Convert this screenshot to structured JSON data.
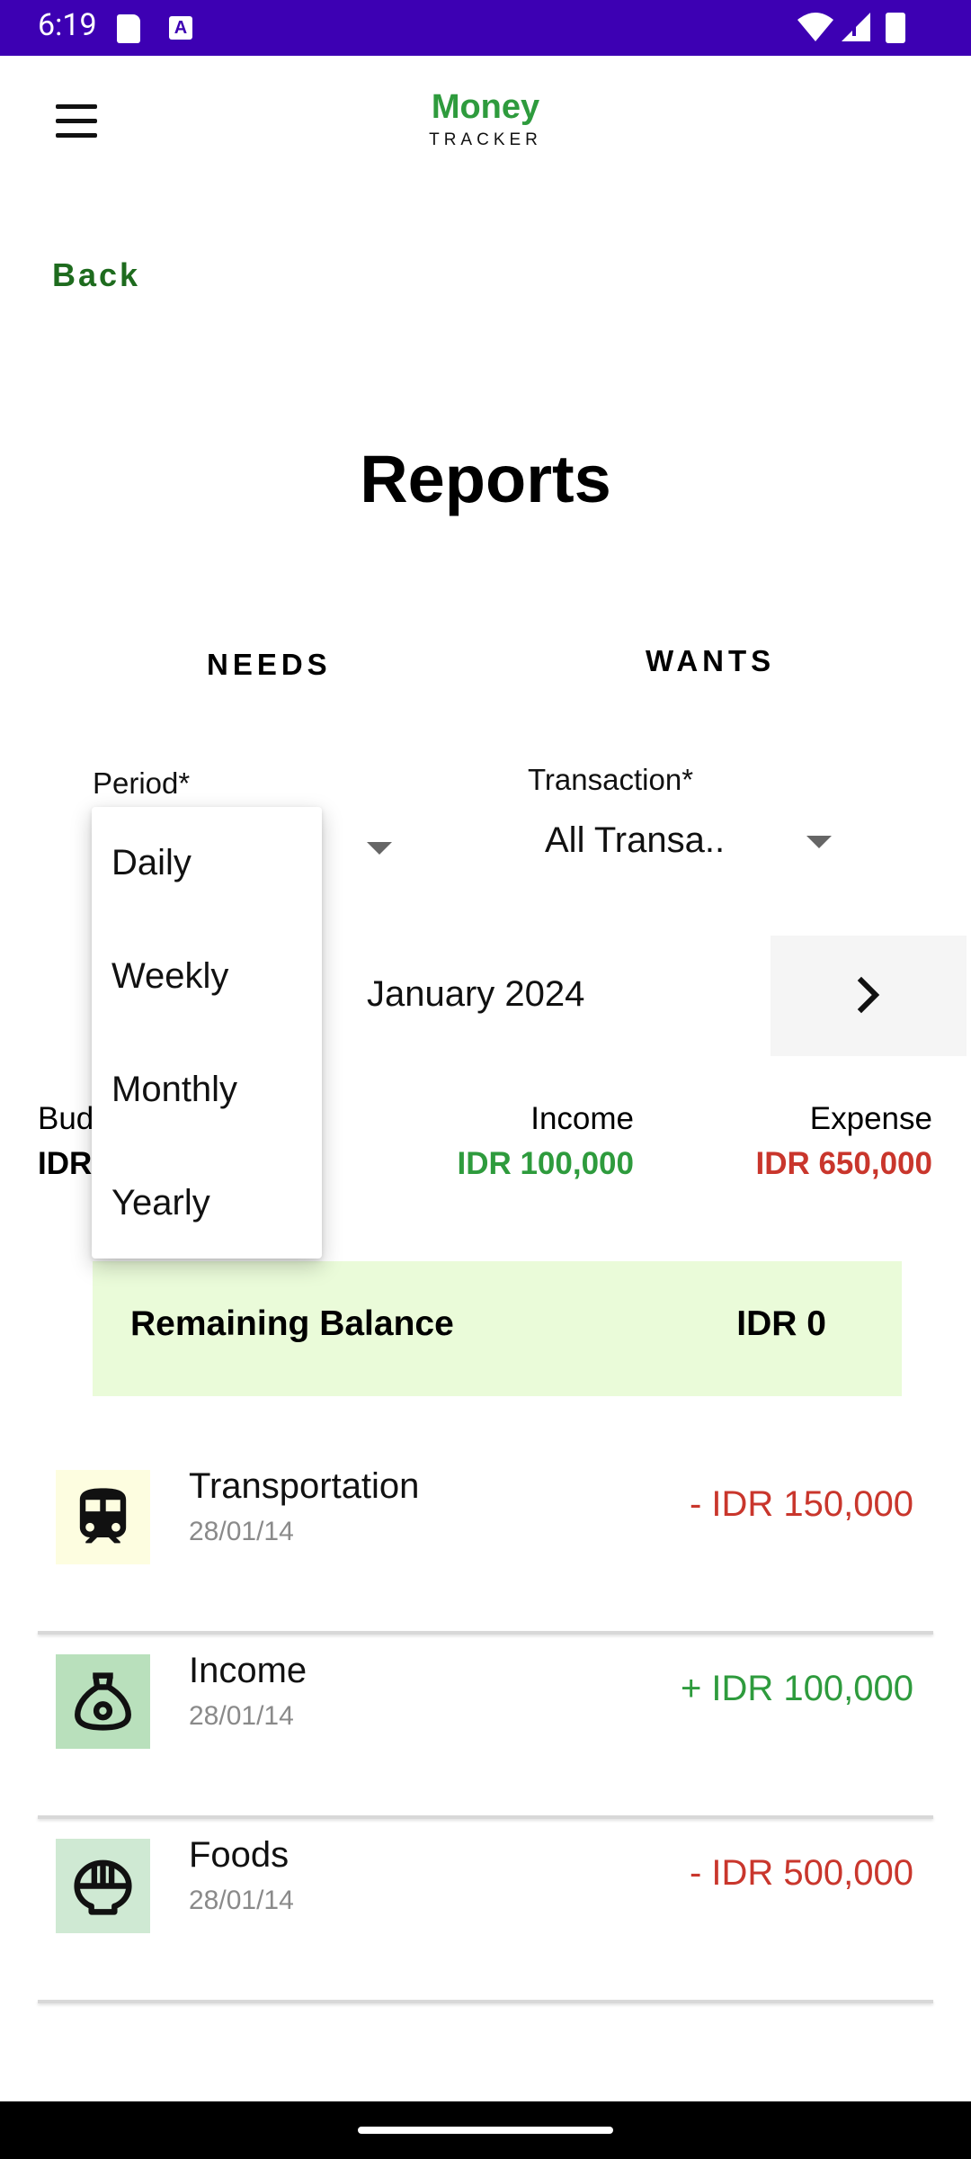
{
  "status_bar": {
    "time": "6:19",
    "icons": [
      "sd-card-icon",
      "a-icon",
      "wifi-icon",
      "signal-icon",
      "battery-icon"
    ]
  },
  "app_bar": {
    "logo_main": "Money",
    "logo_sub": "TRACKER"
  },
  "back_label": "Back",
  "page_title": "Reports",
  "tabs": [
    {
      "label": "NEEDS"
    },
    {
      "label": "WANTS"
    }
  ],
  "filters": {
    "period_label": "Period*",
    "transaction_label": "Transaction*",
    "transaction_value": "All Transa.."
  },
  "period_dropdown": {
    "options": [
      "Daily",
      "Weekly",
      "Monthly",
      "Yearly"
    ]
  },
  "month_nav": {
    "month": "January 2024"
  },
  "summary": {
    "budget_label": "Bud",
    "budget_value": "IDR",
    "income_label": "Income",
    "income_value": "IDR 100,000",
    "expense_label": "Expense",
    "expense_value": "IDR 650,000"
  },
  "balance": {
    "label": "Remaining Balance",
    "value": "IDR 0"
  },
  "transactions": [
    {
      "name": "Transportation",
      "date": "28/01/14",
      "amount": "- IDR 150,000",
      "icon": "train-icon"
    },
    {
      "name": "Income",
      "date": "28/01/14",
      "amount": "+ IDR 100,000",
      "icon": "money-bag-icon"
    },
    {
      "name": "Foods",
      "date": "28/01/14",
      "amount": "- IDR 500,000",
      "icon": "food-bowl-icon"
    }
  ],
  "colors": {
    "status_bar": "#3d00b3",
    "brand_green": "#2e9b3d",
    "back_green": "#1e6b1e",
    "expense_red": "#c9362c",
    "balance_card": "#eafbd9",
    "transport_icon_bg": "#fdfde0",
    "income_icon_bg": "#b9e0bc",
    "food_icon_bg": "#cfe9d3"
  }
}
